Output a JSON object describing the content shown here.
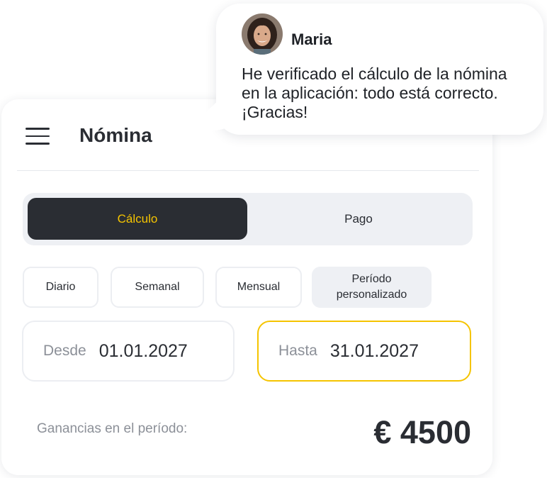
{
  "header": {
    "title": "Nómina",
    "menu_icon": "hamburger-menu-icon"
  },
  "segmented": {
    "active_label": "Cálculo",
    "inactive_label": "Pago"
  },
  "periods": {
    "daily": "Diario",
    "weekly": "Semanal",
    "monthly": "Mensual",
    "custom": "Período personalizado"
  },
  "dates": {
    "from_label": "Desde",
    "from_value": "01.01.2027",
    "to_label": "Hasta",
    "to_value": "31.01.2027"
  },
  "earnings": {
    "label": "Ganancias en el período:",
    "value": "€ 4500"
  },
  "chat": {
    "author": "Maria",
    "message": "He verificado el cálculo de la nómina en la aplicación: todo está correcto. ¡Gracias!"
  },
  "colors": {
    "accent": "#f5c400",
    "dark": "#2a2d33",
    "muted": "#8c9098",
    "surface": "#eef0f4"
  }
}
